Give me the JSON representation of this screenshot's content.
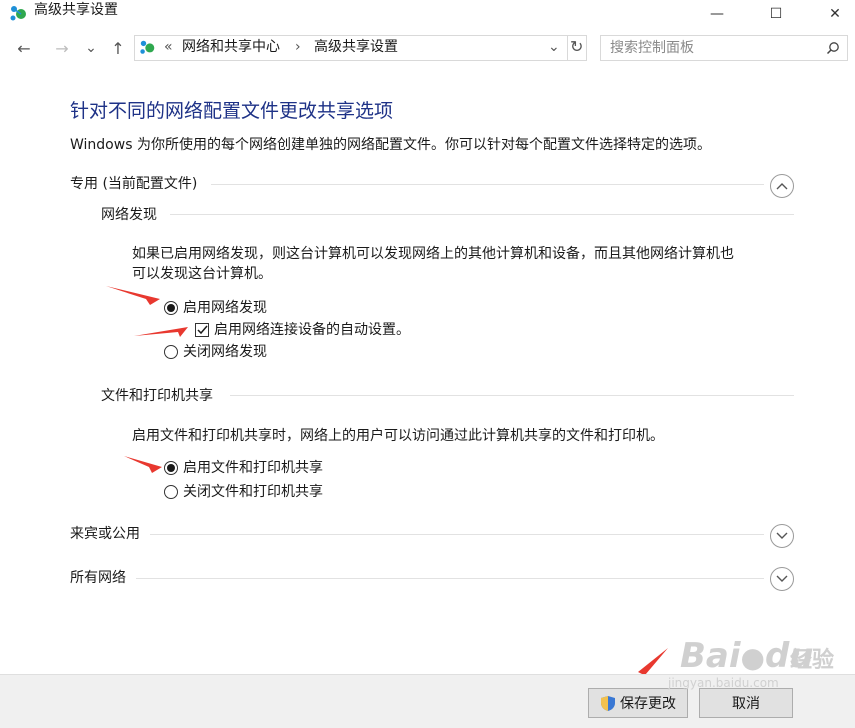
{
  "window": {
    "title": "高级共享设置",
    "minimize": "—",
    "maximize": "☐",
    "close": "✕"
  },
  "nav": {
    "back": "←",
    "forward": "→",
    "recent": "⌄",
    "up": "↑",
    "breadcrumb_sep0": "«",
    "breadcrumb": [
      "网络和共享中心",
      "高级共享设置"
    ],
    "breadcrumb_sep": "›",
    "dropdown": "⌄",
    "refresh": "↻",
    "search_placeholder": "搜索控制面板"
  },
  "content": {
    "heading": "针对不同的网络配置文件更改共享选项",
    "description": "Windows 为你所使用的每个网络创建单独的网络配置文件。你可以针对每个配置文件选择特定的选项。",
    "profiles": [
      {
        "label": "专用 (当前配置文件)",
        "expanded": true
      },
      {
        "label": "来宾或公用",
        "expanded": false
      },
      {
        "label": "所有网络",
        "expanded": false
      }
    ],
    "network_discovery": {
      "title": "网络发现",
      "text_line1": "如果已启用网络发现，则这台计算机可以发现网络上的其他计算机和设备，而且其他网络计算机也",
      "text_line2": "可以发现这台计算机。",
      "enable_label": "启用网络发现",
      "auto_setup_label": "启用网络连接设备的自动设置。",
      "disable_label": "关闭网络发现",
      "enabled": true,
      "auto_setup_checked": true
    },
    "file_sharing": {
      "title": "文件和打印机共享",
      "text": "启用文件和打印机共享时，网络上的用户可以访问通过此计算机共享的文件和打印机。",
      "enable_label": "启用文件和打印机共享",
      "disable_label": "关闭文件和打印机共享",
      "enabled": true
    }
  },
  "footer": {
    "save_label": "保存更改",
    "cancel_label": "取消"
  },
  "watermark": {
    "brand": "Bai",
    "brand2": "du",
    "brand_cn": "经验",
    "url": "jingyan.baidu.com"
  },
  "colors": {
    "heading": "#1e3287",
    "annotation_arrow": "#e8382f"
  }
}
